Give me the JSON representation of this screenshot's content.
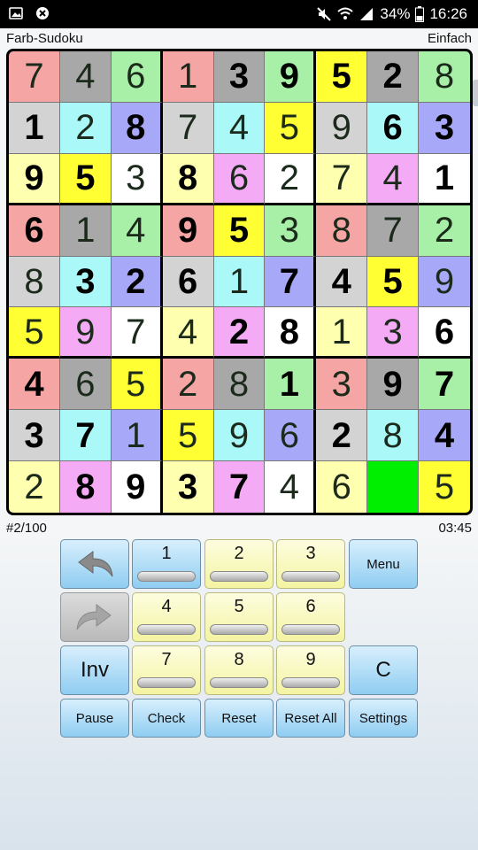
{
  "statusbar": {
    "battery": "34%",
    "time": "16:26",
    "icons": [
      "image-icon",
      "app-icon",
      "mute-icon",
      "wifi-icon",
      "signal-icon",
      "battery-icon"
    ]
  },
  "header": {
    "title": "Farb-Sudoku",
    "difficulty": "Einfach"
  },
  "board": {
    "rows": [
      [
        {
          "v": "7",
          "bg": "#f6a5a5",
          "given": false
        },
        {
          "v": "4",
          "bg": "#a8a8a8",
          "given": false
        },
        {
          "v": "6",
          "bg": "#a8f0a8",
          "given": false
        },
        {
          "v": "1",
          "bg": "#f6a5a5",
          "given": false
        },
        {
          "v": "3",
          "bg": "#a8a8a8",
          "given": true
        },
        {
          "v": "9",
          "bg": "#a8f0a8",
          "given": true
        },
        {
          "v": "5",
          "bg": "#ffff33",
          "given": true
        },
        {
          "v": "2",
          "bg": "#a8a8a8",
          "given": true
        },
        {
          "v": "8",
          "bg": "#a8f0a8",
          "given": false
        }
      ],
      [
        {
          "v": "1",
          "bg": "#d3d3d3",
          "given": true
        },
        {
          "v": "2",
          "bg": "#aaf8f8",
          "given": false
        },
        {
          "v": "8",
          "bg": "#a8a8f8",
          "given": true
        },
        {
          "v": "7",
          "bg": "#d3d3d3",
          "given": false
        },
        {
          "v": "4",
          "bg": "#aaf8f8",
          "given": false
        },
        {
          "v": "5",
          "bg": "#ffff33",
          "given": false
        },
        {
          "v": "9",
          "bg": "#d3d3d3",
          "given": false
        },
        {
          "v": "6",
          "bg": "#aaf8f8",
          "given": true
        },
        {
          "v": "3",
          "bg": "#a8a8f8",
          "given": true
        }
      ],
      [
        {
          "v": "9",
          "bg": "#ffffb0",
          "given": true
        },
        {
          "v": "5",
          "bg": "#ffff33",
          "given": true
        },
        {
          "v": "3",
          "bg": "#ffffff",
          "given": false
        },
        {
          "v": "8",
          "bg": "#ffffb0",
          "given": true
        },
        {
          "v": "6",
          "bg": "#f5aaf5",
          "given": false
        },
        {
          "v": "2",
          "bg": "#ffffff",
          "given": false
        },
        {
          "v": "7",
          "bg": "#ffffb0",
          "given": false
        },
        {
          "v": "4",
          "bg": "#f5aaf5",
          "given": false
        },
        {
          "v": "1",
          "bg": "#ffffff",
          "given": true
        }
      ],
      [
        {
          "v": "6",
          "bg": "#f6a5a5",
          "given": true
        },
        {
          "v": "1",
          "bg": "#a8a8a8",
          "given": false
        },
        {
          "v": "4",
          "bg": "#a8f0a8",
          "given": false
        },
        {
          "v": "9",
          "bg": "#f6a5a5",
          "given": true
        },
        {
          "v": "5",
          "bg": "#ffff33",
          "given": true
        },
        {
          "v": "3",
          "bg": "#a8f0a8",
          "given": false
        },
        {
          "v": "8",
          "bg": "#f6a5a5",
          "given": false
        },
        {
          "v": "7",
          "bg": "#a8a8a8",
          "given": false
        },
        {
          "v": "2",
          "bg": "#a8f0a8",
          "given": false
        }
      ],
      [
        {
          "v": "8",
          "bg": "#d3d3d3",
          "given": false
        },
        {
          "v": "3",
          "bg": "#aaf8f8",
          "given": true
        },
        {
          "v": "2",
          "bg": "#a8a8f8",
          "given": true
        },
        {
          "v": "6",
          "bg": "#d3d3d3",
          "given": true
        },
        {
          "v": "1",
          "bg": "#aaf8f8",
          "given": false
        },
        {
          "v": "7",
          "bg": "#a8a8f8",
          "given": true
        },
        {
          "v": "4",
          "bg": "#d3d3d3",
          "given": true
        },
        {
          "v": "5",
          "bg": "#ffff33",
          "given": true
        },
        {
          "v": "9",
          "bg": "#a8a8f8",
          "given": false
        }
      ],
      [
        {
          "v": "5",
          "bg": "#ffff33",
          "given": false
        },
        {
          "v": "9",
          "bg": "#f5aaf5",
          "given": false
        },
        {
          "v": "7",
          "bg": "#ffffff",
          "given": false
        },
        {
          "v": "4",
          "bg": "#ffffb0",
          "given": false
        },
        {
          "v": "2",
          "bg": "#f5aaf5",
          "given": true
        },
        {
          "v": "8",
          "bg": "#ffffff",
          "given": true
        },
        {
          "v": "1",
          "bg": "#ffffb0",
          "given": false
        },
        {
          "v": "3",
          "bg": "#f5aaf5",
          "given": false
        },
        {
          "v": "6",
          "bg": "#ffffff",
          "given": true
        }
      ],
      [
        {
          "v": "4",
          "bg": "#f6a5a5",
          "given": true
        },
        {
          "v": "6",
          "bg": "#a8a8a8",
          "given": false
        },
        {
          "v": "5",
          "bg": "#ffff33",
          "given": false
        },
        {
          "v": "2",
          "bg": "#f6a5a5",
          "given": false
        },
        {
          "v": "8",
          "bg": "#a8a8a8",
          "given": false
        },
        {
          "v": "1",
          "bg": "#a8f0a8",
          "given": true
        },
        {
          "v": "3",
          "bg": "#f6a5a5",
          "given": false
        },
        {
          "v": "9",
          "bg": "#a8a8a8",
          "given": true
        },
        {
          "v": "7",
          "bg": "#a8f0a8",
          "given": true
        }
      ],
      [
        {
          "v": "3",
          "bg": "#d3d3d3",
          "given": true
        },
        {
          "v": "7",
          "bg": "#aaf8f8",
          "given": true
        },
        {
          "v": "1",
          "bg": "#a8a8f8",
          "given": false
        },
        {
          "v": "5",
          "bg": "#ffff33",
          "given": false
        },
        {
          "v": "9",
          "bg": "#aaf8f8",
          "given": false
        },
        {
          "v": "6",
          "bg": "#a8a8f8",
          "given": false
        },
        {
          "v": "2",
          "bg": "#d3d3d3",
          "given": true
        },
        {
          "v": "8",
          "bg": "#aaf8f8",
          "given": false
        },
        {
          "v": "4",
          "bg": "#a8a8f8",
          "given": true
        }
      ],
      [
        {
          "v": "2",
          "bg": "#ffffb0",
          "given": false
        },
        {
          "v": "8",
          "bg": "#f5aaf5",
          "given": true
        },
        {
          "v": "9",
          "bg": "#ffffff",
          "given": true
        },
        {
          "v": "3",
          "bg": "#ffffb0",
          "given": true
        },
        {
          "v": "7",
          "bg": "#f5aaf5",
          "given": true
        },
        {
          "v": "4",
          "bg": "#ffffff",
          "given": false
        },
        {
          "v": "6",
          "bg": "#ffffb0",
          "given": false
        },
        {
          "v": "",
          "bg": "#00ee00",
          "given": false
        },
        {
          "v": "5",
          "bg": "#ffff33",
          "given": false
        }
      ]
    ]
  },
  "info": {
    "puzzle_number": "#2/100",
    "timer": "03:45"
  },
  "keypad": {
    "numbers": [
      "1",
      "2",
      "3",
      "4",
      "5",
      "6",
      "7",
      "8",
      "9"
    ],
    "menu": "Menu",
    "inv": "Inv",
    "clear": "C",
    "pause": "Pause",
    "check": "Check",
    "reset": "Reset",
    "reset_all": "Reset All",
    "settings": "Settings"
  }
}
